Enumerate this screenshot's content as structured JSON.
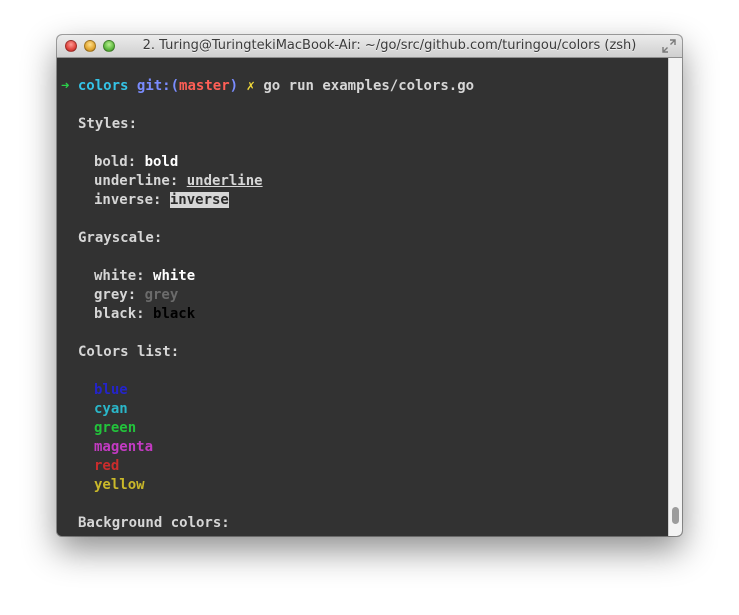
{
  "window": {
    "title": "2. Turing@TuringtekiMacBook-Air: ~/go/src/github.com/turingou/colors (zsh)"
  },
  "prompt": {
    "arrow": "➜",
    "dir": "colors",
    "git_prefix": "git:(",
    "branch": "master",
    "git_suffix": ")",
    "dirty": "✗",
    "command": "go run examples/colors.go"
  },
  "output": {
    "styles_header": "Styles:",
    "bold_label": "bold: ",
    "bold_value": "bold",
    "underline_label": "underline: ",
    "underline_value": "underline",
    "inverse_label": "inverse: ",
    "inverse_value": "inverse",
    "grayscale_header": "Grayscale:",
    "white_label": "white: ",
    "white_value": "white",
    "grey_label": "grey: ",
    "grey_value": "grey",
    "black_label": "black: ",
    "black_value": "black",
    "colors_header": "Colors list:",
    "colors": [
      {
        "label": "blue",
        "color": "#2424c8"
      },
      {
        "label": "cyan",
        "color": "#2ab6c8"
      },
      {
        "label": "green",
        "color": "#22c33b"
      },
      {
        "label": "magenta",
        "color": "#c33ac2"
      },
      {
        "label": "red",
        "color": "#c92c2c"
      },
      {
        "label": "yellow",
        "color": "#c9b82a"
      }
    ],
    "background_header": "Background colors:"
  },
  "palette": {
    "terminal_bg": "#323232",
    "foreground": "#d6d6d6",
    "grey": "#6b6b6b",
    "black": "#000000"
  }
}
